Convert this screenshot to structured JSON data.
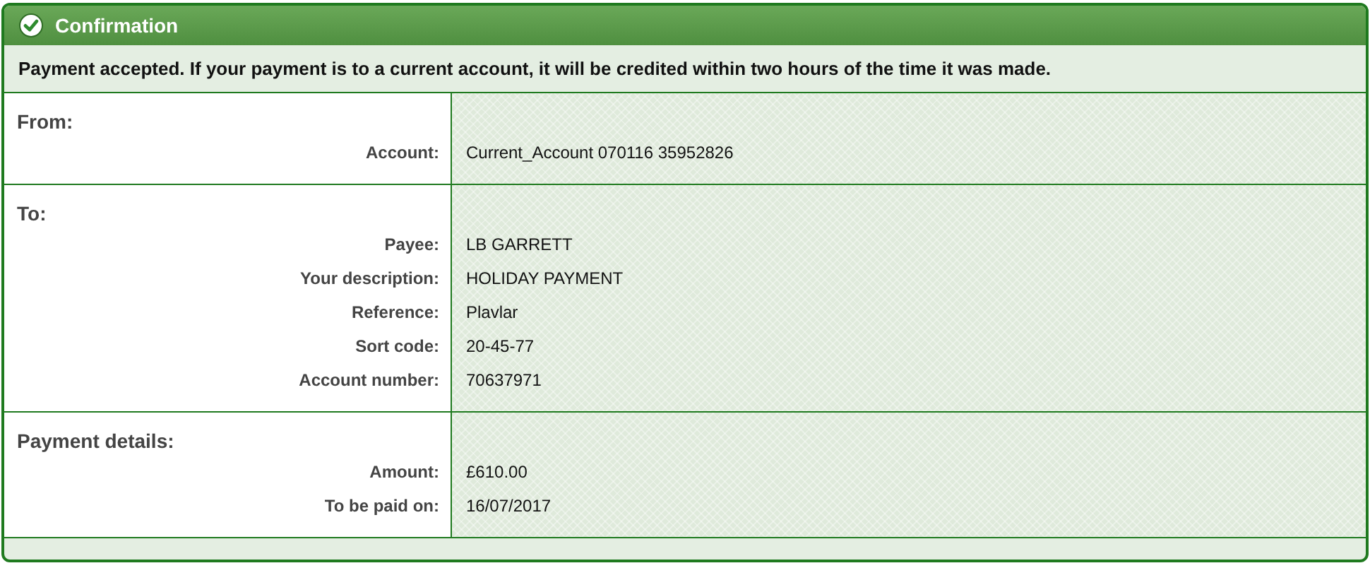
{
  "panel": {
    "title": "Confirmation"
  },
  "message": "Payment accepted. If your payment is to a current account, it will be credited within two hours of the time it was made.",
  "sections": [
    {
      "heading": "From:",
      "rows": [
        {
          "label": "Account:",
          "value": "Current_Account 070116 35952826"
        }
      ]
    },
    {
      "heading": "To:",
      "rows": [
        {
          "label": "Payee:",
          "value": "LB GARRETT"
        },
        {
          "label": "Your description:",
          "value": "HOLIDAY PAYMENT"
        },
        {
          "label": "Reference:",
          "value": "Plavlar"
        },
        {
          "label": "Sort code:",
          "value": "20-45-77"
        },
        {
          "label": "Account number:",
          "value": "70637971"
        }
      ]
    },
    {
      "heading": "Payment details:",
      "rows": [
        {
          "label": "Amount:",
          "value": "£610.00"
        },
        {
          "label": "To be paid on:",
          "value": "16/07/2017"
        }
      ]
    }
  ]
}
